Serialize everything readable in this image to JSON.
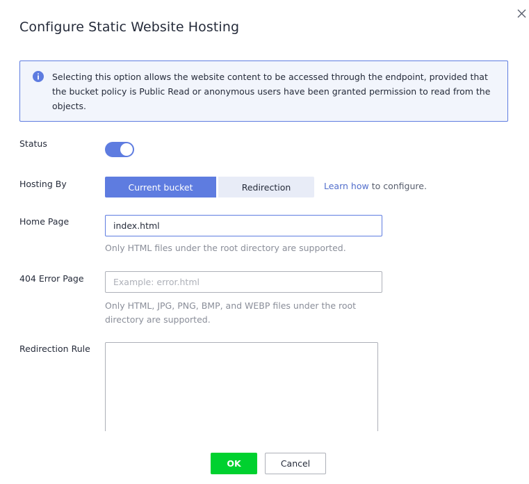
{
  "dialog": {
    "title": "Configure Static Website Hosting",
    "close_icon": "close-icon"
  },
  "info": {
    "icon": "info-icon",
    "text": "Selecting this option allows the website content to be accessed through the endpoint, provided that the bucket policy is Public Read or anonymous users have been granted permission to read from the objects."
  },
  "form": {
    "status": {
      "label": "Status",
      "enabled": true
    },
    "hosting_by": {
      "label": "Hosting By",
      "options": [
        "Current bucket",
        "Redirection"
      ],
      "selected": "Current bucket",
      "learn_link": "Learn how",
      "learn_suffix": " to configure."
    },
    "home_page": {
      "label": "Home Page",
      "value": "index.html",
      "hint": "Only HTML files under the root directory are supported."
    },
    "error_page": {
      "label": "404 Error Page",
      "value": "",
      "placeholder": "Example: error.html",
      "hint_line1": "Only HTML, JPG, PNG, BMP, and WEBP files under the root",
      "hint_line2": "directory are supported."
    },
    "redirection_rule": {
      "label": "Redirection Rule",
      "value": ""
    }
  },
  "footer": {
    "ok_label": "OK",
    "cancel_label": "Cancel"
  },
  "colors": {
    "accent": "#5e7ce0",
    "ok_green": "#00d12f",
    "info_bg": "#f2f5fc",
    "link": "#526ecc"
  }
}
